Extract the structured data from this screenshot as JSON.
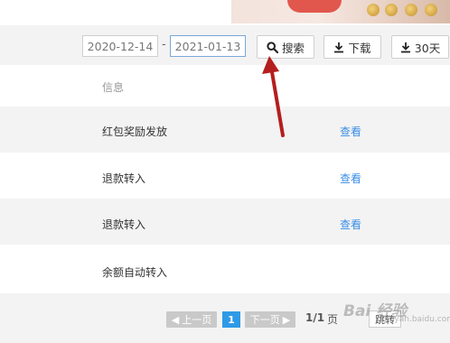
{
  "filter": {
    "start_date": "2020-12-14",
    "separator": "-",
    "end_date": "2021-01-13",
    "search_label": "搜索",
    "download_label": "下载",
    "download30_label": "30天"
  },
  "table": {
    "header": "信息",
    "rows": [
      {
        "info": "红包奖励发放",
        "action": "查看"
      },
      {
        "info": "退款转入",
        "action": "查看"
      },
      {
        "info": "退款转入",
        "action": "查看"
      },
      {
        "info": "余额自动转入",
        "action": ""
      }
    ]
  },
  "pagination": {
    "prev_label": "上一页",
    "current_page": "1",
    "next_label": "下一页",
    "page_info": "1/1",
    "page_unit": "页",
    "jump_label": "跳转"
  },
  "watermark": {
    "text": "Bai 经验",
    "sub": "jingyan.baidu.com"
  },
  "colors": {
    "link": "#3a8ee6",
    "current_page": "#2f9ae6",
    "arrow": "#b51e1e"
  }
}
